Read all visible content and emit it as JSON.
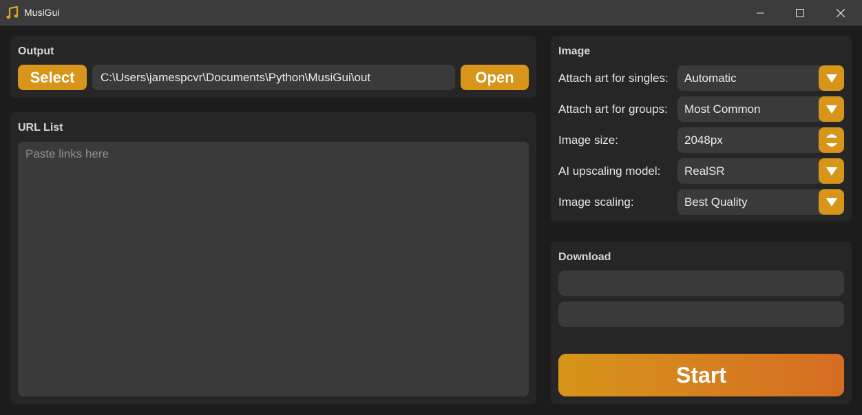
{
  "window": {
    "title": "MusiGui",
    "icons": {
      "app": "music-note-icon",
      "minimize": "minimize-icon",
      "maximize": "maximize-icon",
      "close": "close-icon"
    }
  },
  "output": {
    "title": "Output",
    "select_label": "Select",
    "path_value": "C:\\Users\\jamespcvr\\Documents\\Python\\MusiGui\\out",
    "open_label": "Open"
  },
  "url_list": {
    "title": "URL List",
    "placeholder": "Paste links here"
  },
  "image": {
    "title": "Image",
    "rows": [
      {
        "label": "Attach art for singles:",
        "value": "Automatic",
        "control": "dropdown"
      },
      {
        "label": "Attach art for groups:",
        "value": "Most Common",
        "control": "dropdown"
      },
      {
        "label": "Image size:",
        "value": "2048px",
        "control": "spinbox"
      },
      {
        "label": "AI upscaling model:",
        "value": "RealSR",
        "control": "dropdown"
      },
      {
        "label": "Image scaling:",
        "value": "Best Quality",
        "control": "dropdown"
      }
    ]
  },
  "download": {
    "title": "Download",
    "start_label": "Start"
  },
  "colors": {
    "accent": "#d7951a",
    "accent_end": "#d56d22",
    "background": "#1c1c1c",
    "panel": "#262626",
    "field": "#3a3a3a",
    "titlebar": "#3c3c3c"
  }
}
